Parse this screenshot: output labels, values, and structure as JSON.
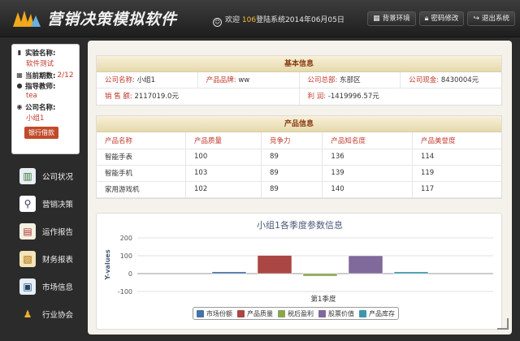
{
  "header": {
    "title": "营销决策模拟软件",
    "welcome_prefix": "欢迎",
    "welcome_num": "106",
    "welcome_suffix": "登陆系统2014年06月05日",
    "buttons": [
      {
        "label": "背景环境",
        "icon": "grid-icon"
      },
      {
        "label": "密码修改",
        "icon": "lock-icon"
      },
      {
        "label": "退出系统",
        "icon": "exit-arrow-icon"
      }
    ]
  },
  "sidebar": {
    "experiment_label": "实验名称:",
    "experiment_value": "软件测试",
    "period_label": "当前期数:",
    "period_value": "2/12",
    "teacher_label": "指导教师:",
    "teacher_value": "tea",
    "company_label": "公司名称:",
    "company_value": "小组1",
    "bank_button": "银行借款",
    "nav": [
      {
        "label": "公司状况",
        "icon": "company-status-icon",
        "color": "#e8e8e8"
      },
      {
        "label": "营销决策",
        "icon": "magnifier-icon",
        "color": "#e8e8e8"
      },
      {
        "label": "运作报告",
        "icon": "report-icon",
        "color": "#e8e8e8"
      },
      {
        "label": "财务报表",
        "icon": "finance-icon",
        "color": "#e8e8e8"
      },
      {
        "label": "市场信息",
        "icon": "market-icon",
        "color": "#e8e8e8"
      },
      {
        "label": "行业协会",
        "icon": "association-icon",
        "color": "#e8e8e8"
      }
    ]
  },
  "basic": {
    "heading": "基本信息",
    "row1": [
      {
        "label": "公司名称:",
        "value": "小组1"
      },
      {
        "label": "产品品牌:",
        "value": "ww"
      },
      {
        "label": "公司总部:",
        "value": "东部区"
      },
      {
        "label": "公司现金:",
        "value": "8430004元"
      }
    ],
    "row2": [
      {
        "label": "销 售 额:",
        "value": "2117019.0元"
      },
      {
        "label": "利 润:",
        "value": "-1419996.57元"
      }
    ]
  },
  "product": {
    "heading": "产品信息",
    "columns": [
      "产品名称",
      "产品质量",
      "竞争力",
      "产品知名度",
      "产品美誉度"
    ],
    "rows": [
      [
        "智能手表",
        "100",
        "89",
        "136",
        "114"
      ],
      [
        "智能手机",
        "103",
        "89",
        "139",
        "119"
      ],
      [
        "家用游戏机",
        "102",
        "89",
        "140",
        "117"
      ]
    ]
  },
  "chart_data": {
    "type": "bar",
    "title": "小组1各季度参数信息",
    "ylabel": "Y-values",
    "xlabel": "",
    "categories": [
      "第1季度"
    ],
    "ylim": [
      -100,
      200
    ],
    "yticks": [
      -100,
      0,
      100,
      200
    ],
    "series": [
      {
        "name": "市场份额",
        "values": [
          10
        ],
        "color": "#4572a7"
      },
      {
        "name": "产品质量",
        "values": [
          102
        ],
        "color": "#aa4643"
      },
      {
        "name": "税后盈利",
        "values": [
          -14
        ],
        "color": "#89a54e"
      },
      {
        "name": "股票价值",
        "values": [
          100
        ],
        "color": "#80699b"
      },
      {
        "name": "产品库存",
        "values": [
          10
        ],
        "color": "#3d96ae"
      }
    ]
  }
}
